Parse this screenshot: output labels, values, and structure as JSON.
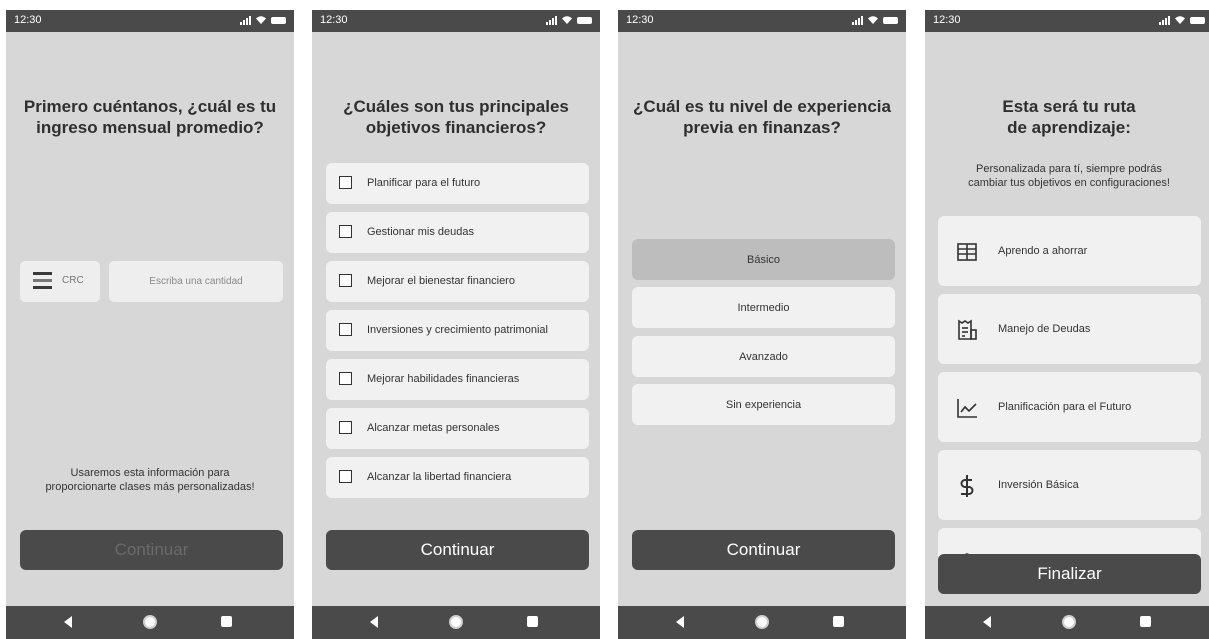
{
  "status": {
    "time": "12:30"
  },
  "screen1": {
    "title": [
      "Primero cuéntanos, ¿cuál es tu",
      "ingreso mensual promedio?"
    ],
    "currency_code": "CRC",
    "amount_placeholder": "Escriba una cantidad",
    "info": [
      "Usaremos esta información para",
      "proporcionarte clases más personalizadas!"
    ],
    "continue_label": "Continuar"
  },
  "screen2": {
    "title": [
      "¿Cuáles son tus principales",
      "objetivos financieros?"
    ],
    "options": [
      {
        "label": "Planificar para el futuro",
        "checked": false
      },
      {
        "label": "Gestionar mis deudas",
        "checked": false
      },
      {
        "label": "Mejorar el bienestar financiero",
        "checked": false
      },
      {
        "label": "Inversiones y crecimiento patrimonial",
        "checked": false
      },
      {
        "label": "Mejorar habilidades financieras",
        "checked": false
      },
      {
        "label": "Alcanzar metas personales",
        "checked": false
      },
      {
        "label": "Alcanzar la libertad financiera",
        "checked": false
      }
    ],
    "continue_label": "Continuar"
  },
  "screen3": {
    "title": [
      "¿Cuál es tu nivel de experiencia",
      "previa en finanzas?"
    ],
    "levels": [
      {
        "label": "Básico",
        "selected": true
      },
      {
        "label": "Intermedio",
        "selected": false
      },
      {
        "label": "Avanzado",
        "selected": false
      },
      {
        "label": "Sin experiencia",
        "selected": false
      }
    ],
    "continue_label": "Continuar"
  },
  "screen4": {
    "title": [
      "Esta será tu ruta",
      "de aprendizaje:"
    ],
    "subtitle": [
      "Personalizada para tí, siempre podrás",
      "cambiar tus objetivos en configuraciones!"
    ],
    "path": [
      {
        "label": "Aprendo a ahorrar",
        "icon": "building-icon"
      },
      {
        "label": "Manejo de Deudas",
        "icon": "receipt-icon"
      },
      {
        "label": "Planificación para el Futuro",
        "icon": "chart-line-icon"
      },
      {
        "label": "Inversión Básica",
        "icon": "dollar-icon"
      },
      {
        "label": "",
        "icon": "shield-icon"
      }
    ],
    "finish_label": "Finalizar"
  },
  "colors": {
    "background": "#d7d7d7",
    "bars": "#4a4a4a",
    "card": "#f1f1f1",
    "selected": "#bdbdbd"
  }
}
